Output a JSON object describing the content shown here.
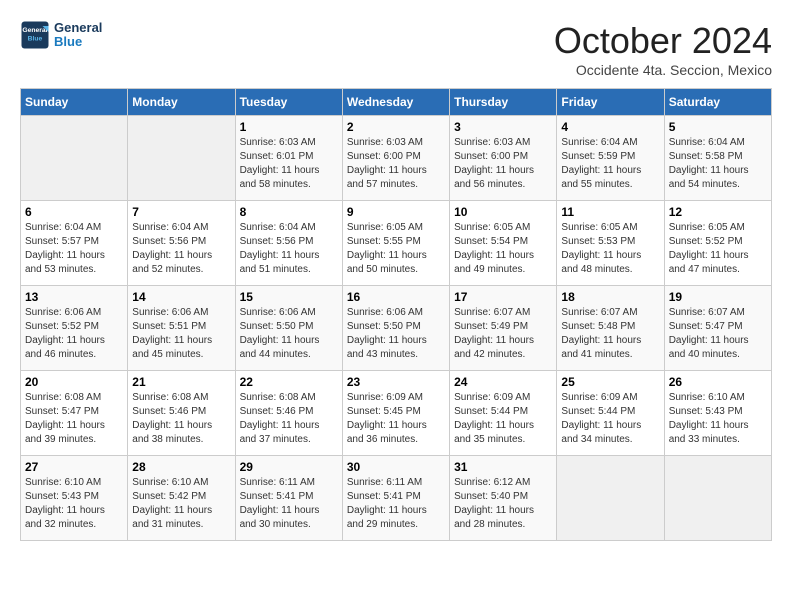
{
  "header": {
    "logo_general": "General",
    "logo_blue": "Blue",
    "month_title": "October 2024",
    "subtitle": "Occidente 4ta. Seccion, Mexico"
  },
  "days_of_week": [
    "Sunday",
    "Monday",
    "Tuesday",
    "Wednesday",
    "Thursday",
    "Friday",
    "Saturday"
  ],
  "weeks": [
    [
      {
        "day": "",
        "info": ""
      },
      {
        "day": "",
        "info": ""
      },
      {
        "day": "1",
        "info": "Sunrise: 6:03 AM\nSunset: 6:01 PM\nDaylight: 11 hours and 58 minutes."
      },
      {
        "day": "2",
        "info": "Sunrise: 6:03 AM\nSunset: 6:00 PM\nDaylight: 11 hours and 57 minutes."
      },
      {
        "day": "3",
        "info": "Sunrise: 6:03 AM\nSunset: 6:00 PM\nDaylight: 11 hours and 56 minutes."
      },
      {
        "day": "4",
        "info": "Sunrise: 6:04 AM\nSunset: 5:59 PM\nDaylight: 11 hours and 55 minutes."
      },
      {
        "day": "5",
        "info": "Sunrise: 6:04 AM\nSunset: 5:58 PM\nDaylight: 11 hours and 54 minutes."
      }
    ],
    [
      {
        "day": "6",
        "info": "Sunrise: 6:04 AM\nSunset: 5:57 PM\nDaylight: 11 hours and 53 minutes."
      },
      {
        "day": "7",
        "info": "Sunrise: 6:04 AM\nSunset: 5:56 PM\nDaylight: 11 hours and 52 minutes."
      },
      {
        "day": "8",
        "info": "Sunrise: 6:04 AM\nSunset: 5:56 PM\nDaylight: 11 hours and 51 minutes."
      },
      {
        "day": "9",
        "info": "Sunrise: 6:05 AM\nSunset: 5:55 PM\nDaylight: 11 hours and 50 minutes."
      },
      {
        "day": "10",
        "info": "Sunrise: 6:05 AM\nSunset: 5:54 PM\nDaylight: 11 hours and 49 minutes."
      },
      {
        "day": "11",
        "info": "Sunrise: 6:05 AM\nSunset: 5:53 PM\nDaylight: 11 hours and 48 minutes."
      },
      {
        "day": "12",
        "info": "Sunrise: 6:05 AM\nSunset: 5:52 PM\nDaylight: 11 hours and 47 minutes."
      }
    ],
    [
      {
        "day": "13",
        "info": "Sunrise: 6:06 AM\nSunset: 5:52 PM\nDaylight: 11 hours and 46 minutes."
      },
      {
        "day": "14",
        "info": "Sunrise: 6:06 AM\nSunset: 5:51 PM\nDaylight: 11 hours and 45 minutes."
      },
      {
        "day": "15",
        "info": "Sunrise: 6:06 AM\nSunset: 5:50 PM\nDaylight: 11 hours and 44 minutes."
      },
      {
        "day": "16",
        "info": "Sunrise: 6:06 AM\nSunset: 5:50 PM\nDaylight: 11 hours and 43 minutes."
      },
      {
        "day": "17",
        "info": "Sunrise: 6:07 AM\nSunset: 5:49 PM\nDaylight: 11 hours and 42 minutes."
      },
      {
        "day": "18",
        "info": "Sunrise: 6:07 AM\nSunset: 5:48 PM\nDaylight: 11 hours and 41 minutes."
      },
      {
        "day": "19",
        "info": "Sunrise: 6:07 AM\nSunset: 5:47 PM\nDaylight: 11 hours and 40 minutes."
      }
    ],
    [
      {
        "day": "20",
        "info": "Sunrise: 6:08 AM\nSunset: 5:47 PM\nDaylight: 11 hours and 39 minutes."
      },
      {
        "day": "21",
        "info": "Sunrise: 6:08 AM\nSunset: 5:46 PM\nDaylight: 11 hours and 38 minutes."
      },
      {
        "day": "22",
        "info": "Sunrise: 6:08 AM\nSunset: 5:46 PM\nDaylight: 11 hours and 37 minutes."
      },
      {
        "day": "23",
        "info": "Sunrise: 6:09 AM\nSunset: 5:45 PM\nDaylight: 11 hours and 36 minutes."
      },
      {
        "day": "24",
        "info": "Sunrise: 6:09 AM\nSunset: 5:44 PM\nDaylight: 11 hours and 35 minutes."
      },
      {
        "day": "25",
        "info": "Sunrise: 6:09 AM\nSunset: 5:44 PM\nDaylight: 11 hours and 34 minutes."
      },
      {
        "day": "26",
        "info": "Sunrise: 6:10 AM\nSunset: 5:43 PM\nDaylight: 11 hours and 33 minutes."
      }
    ],
    [
      {
        "day": "27",
        "info": "Sunrise: 6:10 AM\nSunset: 5:43 PM\nDaylight: 11 hours and 32 minutes."
      },
      {
        "day": "28",
        "info": "Sunrise: 6:10 AM\nSunset: 5:42 PM\nDaylight: 11 hours and 31 minutes."
      },
      {
        "day": "29",
        "info": "Sunrise: 6:11 AM\nSunset: 5:41 PM\nDaylight: 11 hours and 30 minutes."
      },
      {
        "day": "30",
        "info": "Sunrise: 6:11 AM\nSunset: 5:41 PM\nDaylight: 11 hours and 29 minutes."
      },
      {
        "day": "31",
        "info": "Sunrise: 6:12 AM\nSunset: 5:40 PM\nDaylight: 11 hours and 28 minutes."
      },
      {
        "day": "",
        "info": ""
      },
      {
        "day": "",
        "info": ""
      }
    ]
  ]
}
